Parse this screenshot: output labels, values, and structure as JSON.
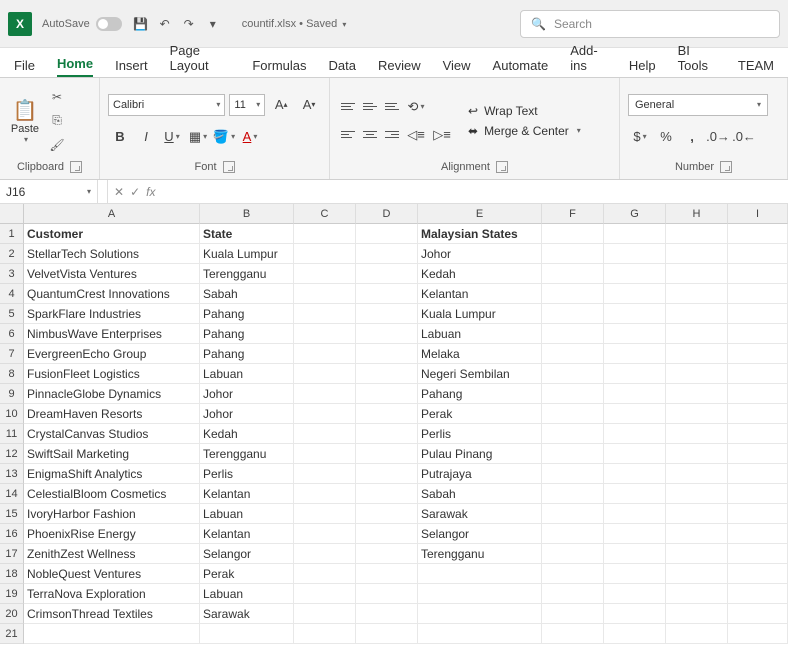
{
  "titlebar": {
    "autosave_label": "AutoSave",
    "autosave_state": "Off",
    "filename": "countif.xlsx • Saved",
    "search_placeholder": "Search"
  },
  "tabs": [
    "File",
    "Home",
    "Insert",
    "Page Layout",
    "Formulas",
    "Data",
    "Review",
    "View",
    "Automate",
    "Add-ins",
    "Help",
    "BI Tools",
    "TEAM"
  ],
  "active_tab": "Home",
  "ribbon": {
    "clipboard": {
      "paste": "Paste",
      "label": "Clipboard"
    },
    "font": {
      "name": "Calibri",
      "size": "11",
      "label": "Font"
    },
    "alignment": {
      "wrap": "Wrap Text",
      "merge": "Merge & Center",
      "label": "Alignment"
    },
    "number": {
      "format": "General",
      "label": "Number"
    }
  },
  "namebox": "J16",
  "fx_label": "fx",
  "columns": [
    "A",
    "B",
    "C",
    "D",
    "E",
    "F",
    "G",
    "H",
    "I"
  ],
  "rows_count": 21,
  "headers": {
    "A": "Customer",
    "B": "State",
    "E": "Malaysian States"
  },
  "data": [
    {
      "A": "StellarTech Solutions",
      "B": "Kuala Lumpur",
      "E": "Johor"
    },
    {
      "A": "VelvetVista Ventures",
      "B": "Terengganu",
      "E": "Kedah"
    },
    {
      "A": "QuantumCrest Innovations",
      "B": "Sabah",
      "E": "Kelantan"
    },
    {
      "A": "SparkFlare Industries",
      "B": "Pahang",
      "E": "Kuala Lumpur"
    },
    {
      "A": "NimbusWave Enterprises",
      "B": "Pahang",
      "E": "Labuan"
    },
    {
      "A": "EvergreenEcho Group",
      "B": "Pahang",
      "E": "Melaka"
    },
    {
      "A": "FusionFleet Logistics",
      "B": "Labuan",
      "E": "Negeri Sembilan"
    },
    {
      "A": "PinnacleGlobe Dynamics",
      "B": "Johor",
      "E": "Pahang"
    },
    {
      "A": "DreamHaven Resorts",
      "B": "Johor",
      "E": "Perak"
    },
    {
      "A": "CrystalCanvas Studios",
      "B": "Kedah",
      "E": "Perlis"
    },
    {
      "A": "SwiftSail Marketing",
      "B": "Terengganu",
      "E": "Pulau Pinang"
    },
    {
      "A": "EnigmaShift Analytics",
      "B": "Perlis",
      "E": "Putrajaya"
    },
    {
      "A": "CelestialBloom Cosmetics",
      "B": "Kelantan",
      "E": "Sabah"
    },
    {
      "A": "IvoryHarbor Fashion",
      "B": "Labuan",
      "E": "Sarawak"
    },
    {
      "A": "PhoenixRise Energy",
      "B": "Kelantan",
      "E": "Selangor"
    },
    {
      "A": "ZenithZest Wellness",
      "B": "Selangor",
      "E": "Terengganu"
    },
    {
      "A": "NobleQuest Ventures",
      "B": "Perak",
      "E": ""
    },
    {
      "A": "TerraNova Exploration",
      "B": "Labuan",
      "E": ""
    },
    {
      "A": "CrimsonThread Textiles",
      "B": "Sarawak",
      "E": ""
    }
  ]
}
